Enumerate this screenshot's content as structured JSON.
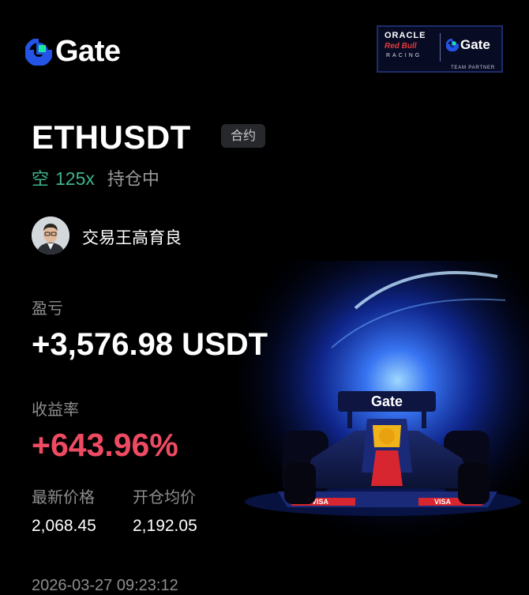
{
  "header": {
    "logo_text": "Gate",
    "partner_badge": {
      "line1": "ORACLE",
      "line2": "Red Bull",
      "line3": "RACING",
      "brand": "Gate",
      "footer": "TEAM PARTNER"
    }
  },
  "position": {
    "pair": "ETHUSDT",
    "contract_tag": "合约",
    "side": "空",
    "leverage": "125x",
    "status": "持仓中"
  },
  "trader": {
    "name": "交易王高育良"
  },
  "pnl": {
    "label": "盈亏",
    "value": "+3,576.98 USDT"
  },
  "roi": {
    "label": "收益率",
    "value": "+643.96%"
  },
  "prices": {
    "latest_label": "最新价格",
    "latest_value": "2,068.45",
    "entry_label": "开仓均价",
    "entry_value": "2,192.05"
  },
  "timestamp": "2026-03-27 09:23:12",
  "colors": {
    "background": "#000000",
    "short_green": "#3fb58a",
    "profit_red": "#ee4b63",
    "muted_text": "#8d8d8d",
    "gate_blue": "#2354e6",
    "gate_teal": "#17e6a1"
  },
  "icons": {
    "logo": "gate-logo-icon",
    "car": "f1-race-car-icon",
    "avatar": "trader-avatar"
  }
}
